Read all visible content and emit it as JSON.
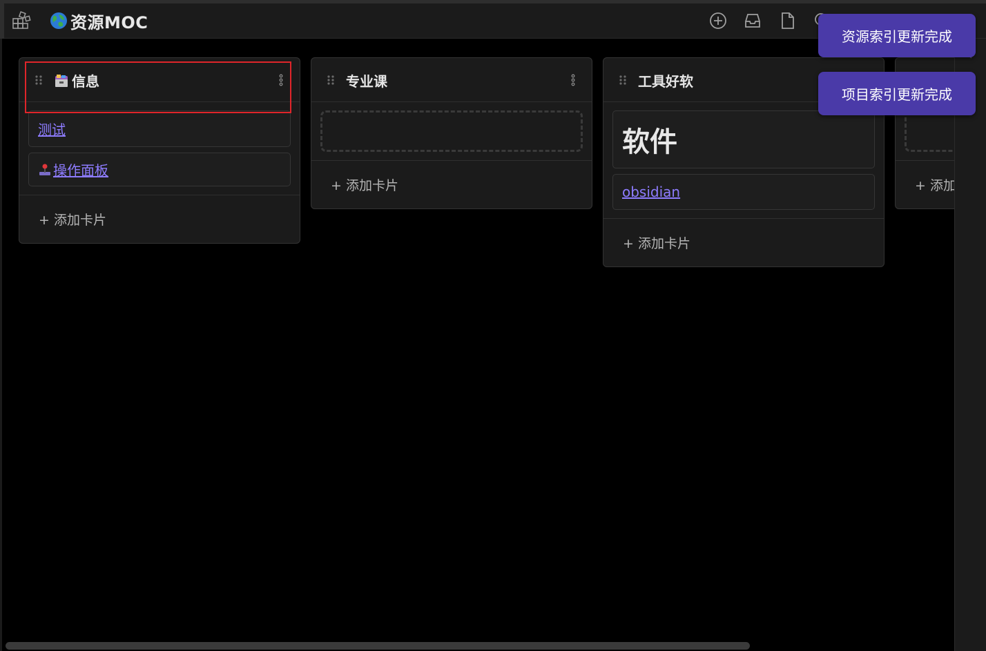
{
  "header": {
    "title": "资源MOC",
    "view_icon": "kanban-grid-icon",
    "title_icon": "globe-icon",
    "actions": [
      {
        "name": "add-circle-icon"
      },
      {
        "name": "archive-icon"
      },
      {
        "name": "file-icon"
      },
      {
        "name": "search-icon"
      },
      {
        "name": "more-icon"
      }
    ]
  },
  "lanes": [
    {
      "title": "信息",
      "title_icon": "card-index-dividers-icon",
      "cards": [
        {
          "type": "link",
          "text": "测试"
        },
        {
          "type": "link",
          "text": "操作面板",
          "icon": "joystick-icon"
        }
      ],
      "add_label": "+ 添加卡片"
    },
    {
      "title": "专业课",
      "cards": [],
      "add_label": "+ 添加卡片"
    },
    {
      "title": "工具好软",
      "cards": [
        {
          "type": "heading",
          "text": "软件"
        },
        {
          "type": "link",
          "text": "obsidian"
        }
      ],
      "add_label": "+ 添加卡片"
    },
    {
      "title": "",
      "cards": [],
      "add_label": "+ 添加"
    }
  ],
  "toasts": [
    {
      "text": "资源索引更新完成"
    },
    {
      "text": "项目索引更新完成"
    }
  ],
  "colors": {
    "accent": "#4a3aa8",
    "link": "#8e7cff",
    "highlight": "#e0252a",
    "lane_bg": "#1b1b1b"
  }
}
